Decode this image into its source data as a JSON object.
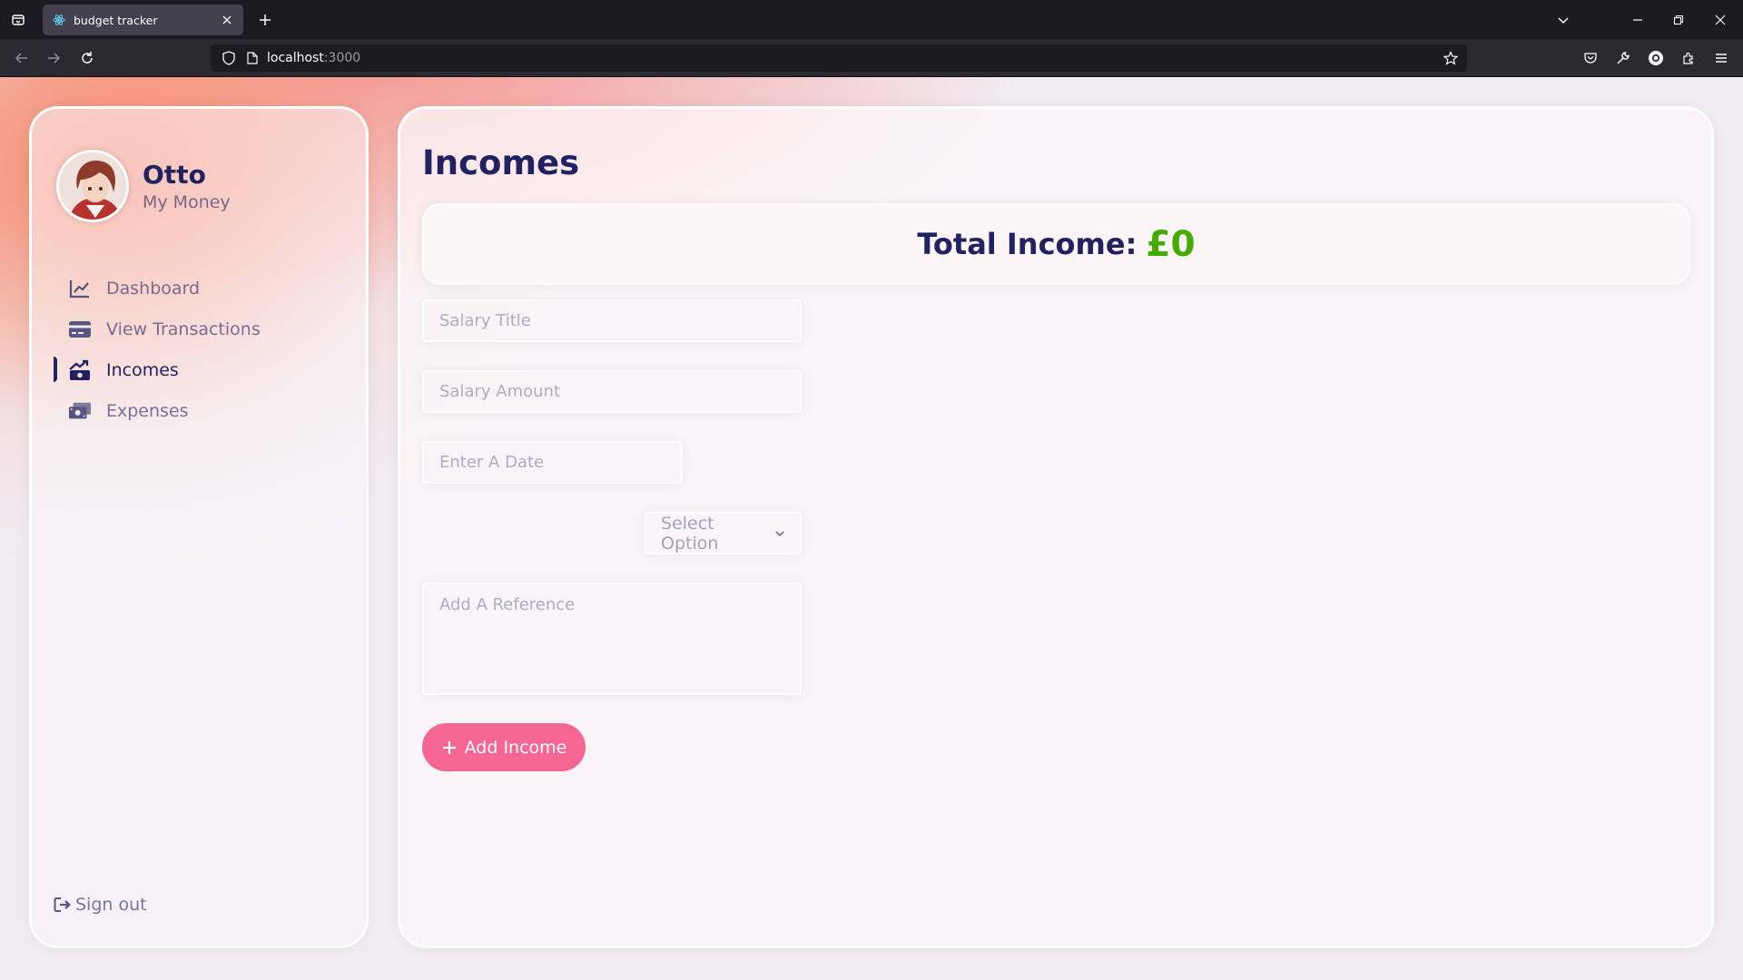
{
  "browser": {
    "tab_title": "budget tracker",
    "url_host": "localhost",
    "url_port": ":3000"
  },
  "sidebar": {
    "user_name": "Otto",
    "user_subtitle": "My Money",
    "menu": [
      {
        "label": "Dashboard",
        "icon": "chart-line-icon",
        "active": false
      },
      {
        "label": "View Transactions",
        "icon": "credit-card-icon",
        "active": false
      },
      {
        "label": "Incomes",
        "icon": "money-bill-trend-up-icon",
        "active": true
      },
      {
        "label": "Expenses",
        "icon": "money-bill-wave-icon",
        "active": false
      }
    ],
    "signout_label": "Sign out"
  },
  "main": {
    "title": "Incomes",
    "total_label": "Total Income:",
    "total_value": "£0",
    "form": {
      "title_placeholder": "Salary Title",
      "amount_placeholder": "Salary Amount",
      "date_placeholder": "Enter A Date",
      "category_selected": "Select Option",
      "reference_placeholder": "Add A Reference",
      "submit_label": "Add Income"
    }
  },
  "colors": {
    "primary": "#222260",
    "income_green": "#42ad00",
    "accent_pink": "#f56692"
  }
}
